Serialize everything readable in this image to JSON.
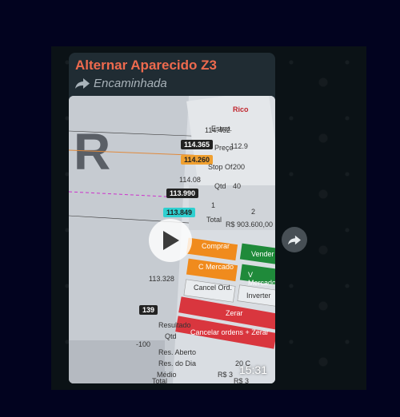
{
  "chat": {
    "sender": "Alternar Aparecido Z3",
    "forwarded_label": "Encaminhada",
    "duration": "15:31"
  },
  "video_frame": {
    "broker": "Rico",
    "price_ticks": [
      "114.462",
      "114.08",
      "113.328"
    ],
    "price_tags": [
      "114.365",
      "114.260",
      "113.990",
      "113.849",
      "139"
    ],
    "form_labels": [
      "Estrat.",
      "Preço",
      "Stop Of.",
      "Qtd",
      "Total"
    ],
    "form_values": [
      "112.9",
      "200",
      "40",
      "R$ 903.600,00"
    ],
    "quantity_buttons": [
      "1",
      "2"
    ],
    "buttons": [
      "Comprar",
      "Vender",
      "C Mercado",
      "V Mercado",
      "Cancel Ord.",
      "Inverter",
      "Zerar",
      "Cancelar ordens + Zerar"
    ],
    "position_labels": [
      "Resultado",
      "Qtd",
      "Res. Aberto",
      "Res. do Dia",
      "Médio",
      "Total"
    ],
    "position_values": [
      "-100",
      "20 C",
      "R$ 3",
      "R$ 3"
    ],
    "letter": "R"
  }
}
